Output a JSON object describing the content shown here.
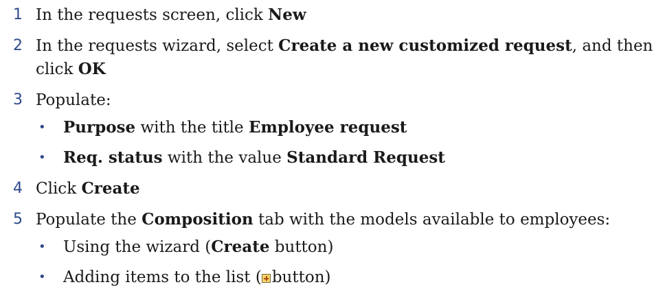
{
  "steps": [
    {
      "number": "1",
      "parts": [
        {
          "t": "In the requests screen, click "
        },
        {
          "t": "New",
          "b": true
        }
      ]
    },
    {
      "number": "2",
      "parts": [
        {
          "t": "In the requests wizard, select "
        },
        {
          "t": "Create a new customized request",
          "b": true
        },
        {
          "t": ", and then click "
        },
        {
          "t": "OK",
          "b": true
        }
      ]
    },
    {
      "number": "3",
      "parts": [
        {
          "t": "Populate:"
        }
      ],
      "subs": [
        [
          {
            "t": "Purpose",
            "b": true
          },
          {
            "t": " with the title "
          },
          {
            "t": "Employee request",
            "b": true
          }
        ],
        [
          {
            "t": "Req. status",
            "b": true
          },
          {
            "t": " with the value "
          },
          {
            "t": "Standard Request",
            "b": true
          }
        ]
      ]
    },
    {
      "number": "4",
      "parts": [
        {
          "t": "Click "
        },
        {
          "t": "Create",
          "b": true
        }
      ]
    },
    {
      "number": "5",
      "parts": [
        {
          "t": "Populate the "
        },
        {
          "t": "Composition",
          "b": true
        },
        {
          "t": " tab with the models available to employees:"
        }
      ],
      "subs": [
        [
          {
            "t": "Using the wizard ("
          },
          {
            "t": "Create",
            "b": true
          },
          {
            "t": " button)"
          }
        ],
        [
          {
            "t": "Adding items to the list ("
          },
          {
            "icon": "plus-icon"
          },
          {
            "t": "button)"
          }
        ]
      ]
    }
  ],
  "icons": {
    "bullet": "•"
  }
}
